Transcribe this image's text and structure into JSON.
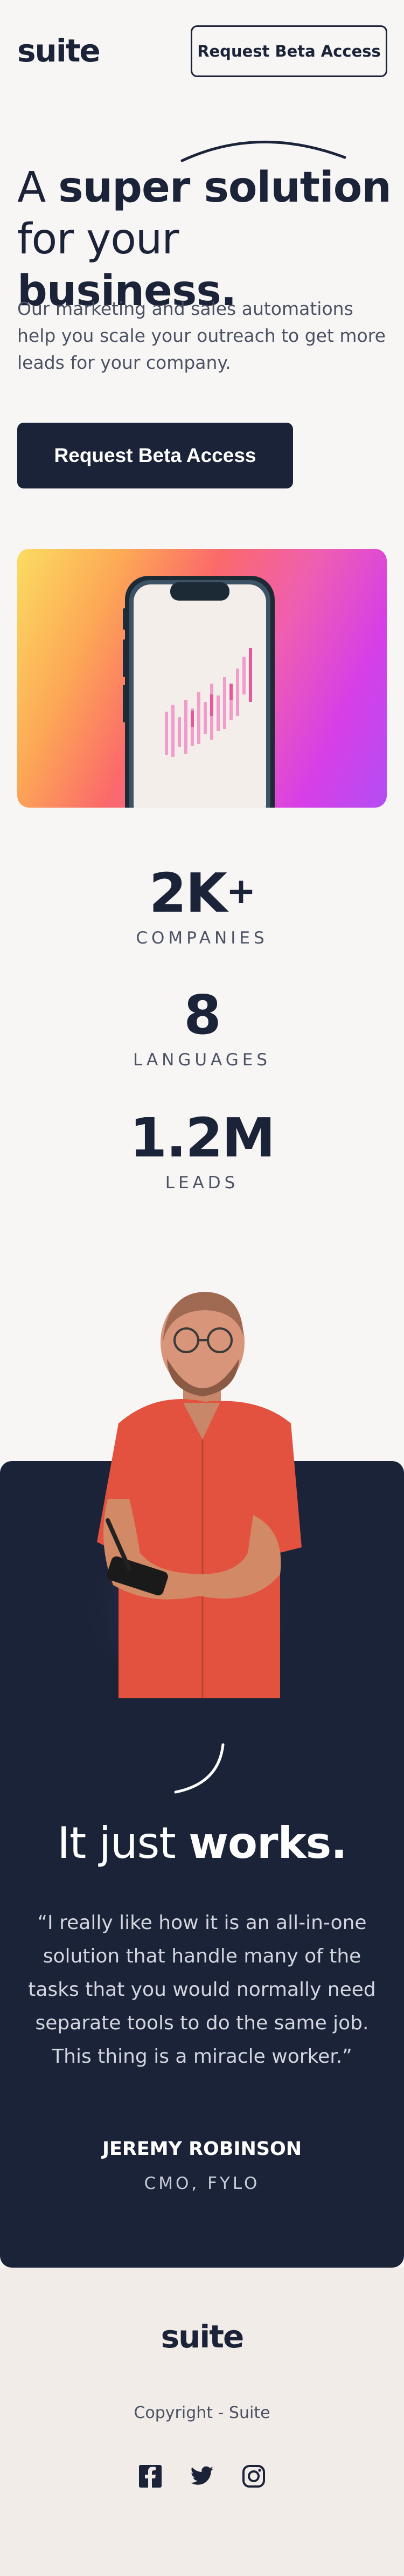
{
  "header": {
    "logo": "suite",
    "cta_label": "Request Beta Access"
  },
  "hero": {
    "title_a": "A ",
    "title_b": "super solution",
    "title_c": "for your ",
    "title_d": "business.",
    "description": "Our marketing and sales automations help you scale your outreach to get more leads for your company.",
    "cta_label": "Request Beta Access",
    "image_colors": [
      "#fbdc62",
      "#fb6a6a",
      "#d73fe6",
      "#b34ef4"
    ]
  },
  "stats": [
    {
      "value": "2K",
      "suffix": "+",
      "label": "COMPANIES"
    },
    {
      "value": "8",
      "suffix": "",
      "label": "LANGUAGES"
    },
    {
      "value": "1.2M",
      "suffix": "",
      "label": "LEADS"
    }
  ],
  "testimonial": {
    "heading_a": "It just ",
    "heading_b": "works.",
    "quote": "“I really like how it is an all-in-one solution that handle many of the tasks that you would normally need separate tools to do the same job. This thing is a miracle worker.”",
    "author": "JEREMY ROBINSON",
    "role": "CMO, FYLO"
  },
  "footer": {
    "logo": "suite",
    "copyright": "Copyright - Suite",
    "socials": [
      "facebook-icon",
      "twitter-icon",
      "instagram-icon"
    ]
  },
  "colors": {
    "navy": "#1b2338",
    "background": "#f8f6f5",
    "footer_background": "#f2ece8"
  }
}
